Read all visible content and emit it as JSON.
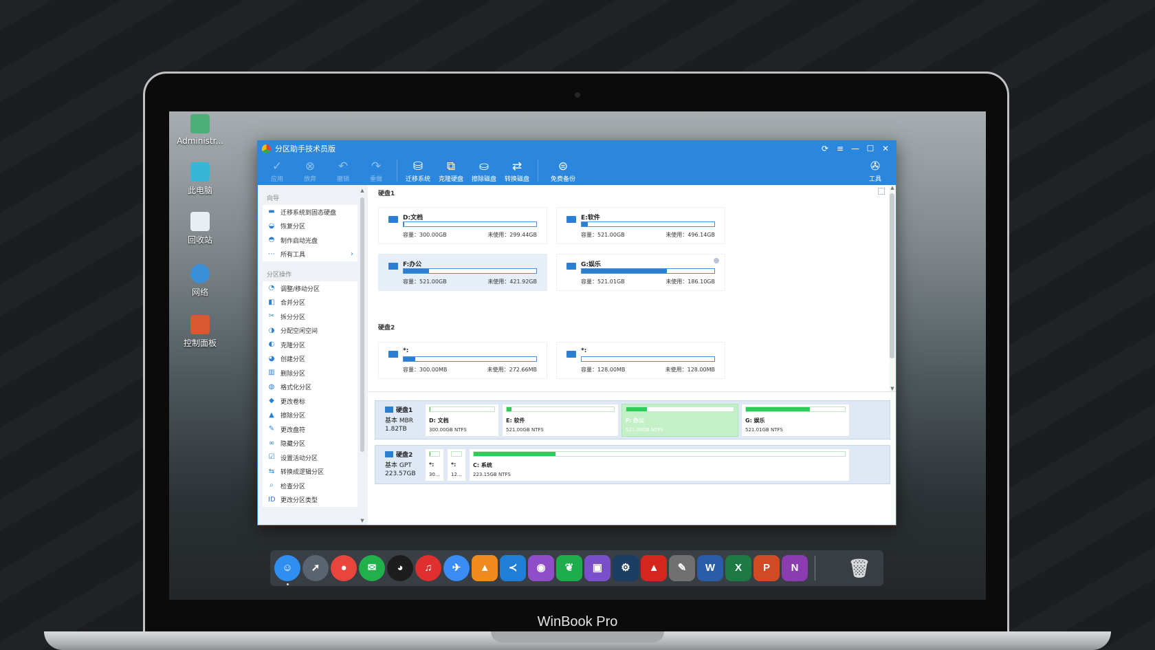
{
  "brand_label": "WinBook Pro",
  "desktop_icons": [
    {
      "label": "Administr...",
      "icon": "user-icon",
      "color": "#4caf78"
    },
    {
      "label": "此电脑",
      "icon": "computer-icon",
      "color": "#39b5d8"
    },
    {
      "label": "回收站",
      "icon": "recycle-bin-icon",
      "color": "#e8eef2"
    },
    {
      "label": "网络",
      "icon": "network-icon",
      "color": "#3a8fd9"
    },
    {
      "label": "控制面板",
      "icon": "control-panel-icon",
      "color": "#d9582f"
    }
  ],
  "window": {
    "title": "分区助手技术员版",
    "controls": {
      "refresh": "⟳",
      "menu": "≡",
      "minimize": "—",
      "maximize": "☐",
      "close": "✕"
    }
  },
  "toolbar": {
    "apply": "应用",
    "discard": "放弃",
    "undo": "撤销",
    "redo": "重做",
    "migrate": "迁移系统",
    "clone": "克隆硬盘",
    "wipe": "擦除磁盘",
    "convert": "转换磁盘",
    "backup": "免费备份",
    "tools": "工具"
  },
  "sidebar": {
    "wizard_title": "向导",
    "wizard_items": [
      {
        "label": "迁移系统到固态硬盘",
        "icon": "migrate-icon"
      },
      {
        "label": "恢复分区",
        "icon": "recover-icon"
      },
      {
        "label": "制作启动光盘",
        "icon": "boot-disk-icon"
      },
      {
        "label": "所有工具",
        "icon": "more-icon"
      }
    ],
    "partition_title": "分区操作",
    "partition_items": [
      {
        "label": "调整/移动分区"
      },
      {
        "label": "合并分区"
      },
      {
        "label": "拆分分区"
      },
      {
        "label": "分配空闲空间"
      },
      {
        "label": "克隆分区"
      },
      {
        "label": "创建分区"
      },
      {
        "label": "删除分区"
      },
      {
        "label": "格式化分区"
      },
      {
        "label": "更改卷标"
      },
      {
        "label": "擦除分区"
      },
      {
        "label": "更改盘符"
      },
      {
        "label": "隐藏分区"
      },
      {
        "label": "设置活动分区"
      },
      {
        "label": "转换成逻辑分区"
      },
      {
        "label": "检查分区"
      },
      {
        "label": "更改分区类型"
      }
    ]
  },
  "main": {
    "disk1_title": "硬盘1",
    "disk1_cards": [
      {
        "name": "D:文档",
        "capacity": "容量：300.00GB",
        "free": "未使用：299.44GB",
        "used_fraction": 0.002
      },
      {
        "name": "E:软件",
        "capacity": "容量：521.00GB",
        "free": "未使用：496.14GB",
        "used_fraction": 0.048
      },
      {
        "name": "F:办公",
        "capacity": "容量：521.00GB",
        "free": "未使用：421.92GB",
        "used_fraction": 0.19
      },
      {
        "name": "G:娱乐",
        "capacity": "容量：521.01GB",
        "free": "未使用：186.10GB",
        "used_fraction": 0.643
      }
    ],
    "disk2_title": "硬盘2",
    "disk2_cards": [
      {
        "name": "*:",
        "capacity": "容量：300.00MB",
        "free": "未使用：272.66MB",
        "used_fraction": 0.09
      },
      {
        "name": "*:",
        "capacity": "容量：128.00MB",
        "free": "未使用：128.00MB",
        "used_fraction": 0.0
      }
    ]
  },
  "disk_map": [
    {
      "name": "硬盘1",
      "type": "基本 MBR",
      "size": "1.82TB",
      "partitions": [
        {
          "name": "D: 文档",
          "size": "300.00GB NTFS",
          "used_fraction": 0.002
        },
        {
          "name": "E: 软件",
          "size": "521.00GB NTFS",
          "used_fraction": 0.048
        },
        {
          "name": "F: 办公",
          "size": "521.00GB NTFS",
          "used_fraction": 0.19,
          "selected": true
        },
        {
          "name": "G: 娱乐",
          "size": "521.01GB NTFS",
          "used_fraction": 0.643
        }
      ]
    },
    {
      "name": "硬盘2",
      "type": "基本 GPT",
      "size": "223.57GB",
      "partitions": [
        {
          "name": "*:",
          "size": "30...",
          "used_fraction": 0.09
        },
        {
          "name": "*:",
          "size": "12...",
          "used_fraction": 0.0
        },
        {
          "name": "C: 系统",
          "size": "223.15GB NTFS",
          "used_fraction": 0.22
        }
      ]
    }
  ],
  "dock_apps": [
    {
      "name": "finder-icon",
      "glyph": "☺",
      "color": "#2f8ff0"
    },
    {
      "name": "launchpad-icon",
      "glyph": "➚",
      "color": "#5a6470"
    },
    {
      "name": "chrome-icon",
      "glyph": "●",
      "color": "#e8453c"
    },
    {
      "name": "wechat-icon",
      "glyph": "✉",
      "color": "#22b04b"
    },
    {
      "name": "qq-icon",
      "glyph": "◕",
      "color": "#1d1d1d"
    },
    {
      "name": "netease-music-icon",
      "glyph": "♫",
      "color": "#e02f2f"
    },
    {
      "name": "feishu-icon",
      "glyph": "✈",
      "color": "#3b8cf5"
    },
    {
      "name": "vlc-icon",
      "glyph": "▲",
      "color": "#f08a1c"
    },
    {
      "name": "vscode-icon",
      "glyph": "≺",
      "color": "#1f7fd6"
    },
    {
      "name": "github-icon",
      "glyph": "◉",
      "color": "#8f4ec7"
    },
    {
      "name": "evernote-icon",
      "glyph": "❦",
      "color": "#1fad4c"
    },
    {
      "name": "twitch-icon",
      "glyph": "▣",
      "color": "#7b4fc9"
    },
    {
      "name": "steam-icon",
      "glyph": "⚙",
      "color": "#1b3d62"
    },
    {
      "name": "acrobat-icon",
      "glyph": "▲",
      "color": "#d6251f"
    },
    {
      "name": "inkscape-icon",
      "glyph": "✎",
      "color": "#707070"
    },
    {
      "name": "word-icon",
      "glyph": "W",
      "color": "#2b5ca8"
    },
    {
      "name": "excel-icon",
      "glyph": "X",
      "color": "#1d7a43"
    },
    {
      "name": "powerpoint-icon",
      "glyph": "P",
      "color": "#d04a24"
    },
    {
      "name": "onenote-icon",
      "glyph": "N",
      "color": "#8a3cb0"
    }
  ],
  "dock_trash": {
    "name": "trash-icon",
    "glyph": "🗑",
    "color": "#d8dadd"
  }
}
